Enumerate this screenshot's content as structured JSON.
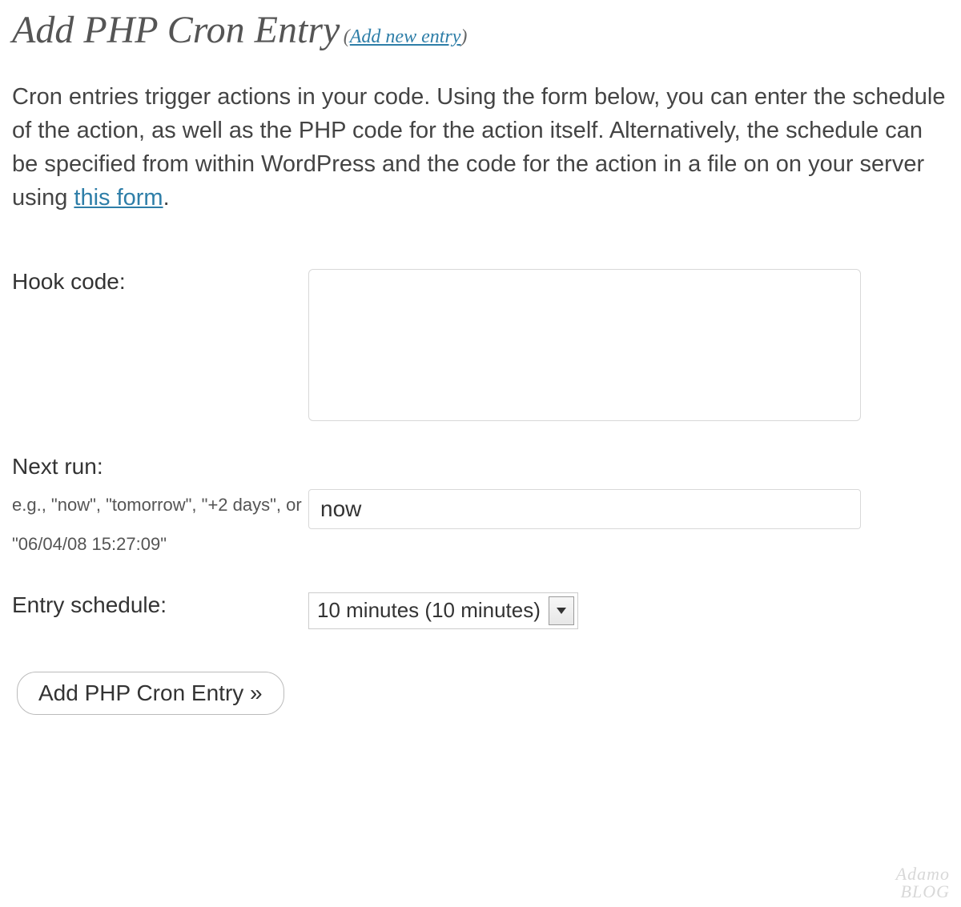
{
  "header": {
    "title": "Add PHP Cron Entry",
    "paren_open": "(",
    "link_text": "Add new entry",
    "paren_close": ")"
  },
  "description": {
    "text_before_link": "Cron entries trigger actions in your code. Using the form below, you can enter the schedule of the action, as well as the PHP code for the action itself. Alternatively, the schedule can be specified from within WordPress and the code for the action in a file on on your server using ",
    "link_text": "this form",
    "text_after_link": "."
  },
  "form": {
    "hook_code": {
      "label": "Hook code:",
      "value": ""
    },
    "next_run": {
      "label": "Next run:",
      "hint": "e.g., \"now\", \"tomorrow\", \"+2 days\", or \"06/04/08 15:27:09\"",
      "value": "now"
    },
    "entry_schedule": {
      "label": "Entry schedule:",
      "selected": "10 minutes (10 minutes)"
    },
    "submit_label": "Add PHP Cron Entry »"
  },
  "watermark": {
    "line1": "Adamo",
    "line2": "BLOG"
  }
}
